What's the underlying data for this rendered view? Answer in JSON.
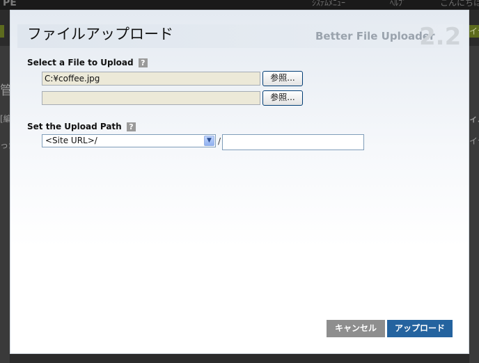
{
  "background": {
    "logo": "PE",
    "top_left": "ｼｽﾃﾑﾒﾆｭｰ",
    "top_mid": "ﾍﾙﾌﾟ",
    "top_right": "こんにちは",
    "left_fragments": [
      "管",
      "[編",
      "っか"
    ],
    "right_fragments": [
      "イテ",
      "ィル",
      "イテ"
    ]
  },
  "dialog": {
    "title": "ファイルアップロード",
    "brand": "Better File Uploader",
    "version": "2.2",
    "file_section": {
      "label": "Select a File to Upload",
      "help": "?",
      "files": [
        {
          "value": "C:¥coffee.jpg",
          "button": "参照..."
        },
        {
          "value": "",
          "button": "参照..."
        }
      ]
    },
    "path_section": {
      "label": "Set the Upload Path",
      "help": "?",
      "select_value": "<Site URL>/",
      "separator": "/",
      "path_value": ""
    },
    "buttons": {
      "cancel": "キャンセル",
      "upload": "アップロード"
    }
  },
  "colors": {
    "upload_button": "#24639f",
    "cancel_button": "#8e8e8e"
  }
}
